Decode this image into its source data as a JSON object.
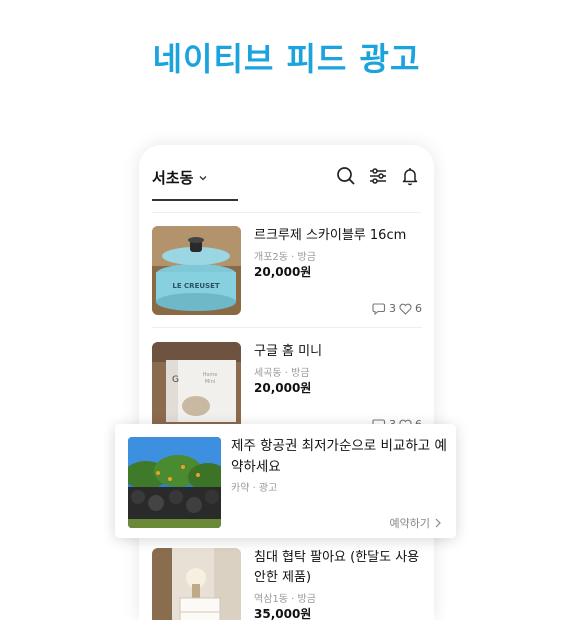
{
  "headline": "네이티브 피드 광고",
  "header": {
    "location_label": "서초동",
    "icons": [
      "chevron-down-icon",
      "search-icon",
      "filter-icon",
      "bell-icon"
    ]
  },
  "feed": {
    "items": [
      {
        "title": "르크루제 스카이블루 16cm",
        "meta": "개포2동 · 방금",
        "price": "20,000원",
        "comments": "3",
        "likes": "6",
        "image": "le-creuset-pot"
      },
      {
        "title": "구글 홈 미니",
        "meta": "세곡동 · 방금",
        "price": "20,000원",
        "comments": "3",
        "likes": "6",
        "image": "google-home-mini-box"
      },
      {
        "title": "침대 협탁 팔아요 (한달도 사용 안한 제품)",
        "meta": "역삼1동 · 방금",
        "price": "35,000원",
        "image": "bedroom-nightstand"
      }
    ]
  },
  "ad": {
    "title": "제주 항공권 최저가순으로 비교하고 예약하세요",
    "meta": "카약 · 광고",
    "cta": "예약하기",
    "image": "jeju-stone-wall-orange-trees"
  },
  "colors": {
    "headline": "#1aa3dd"
  }
}
